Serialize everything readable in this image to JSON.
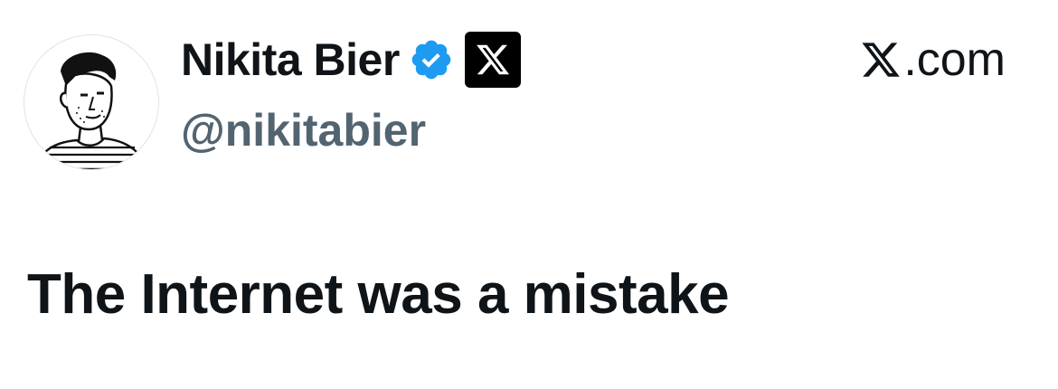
{
  "author": {
    "display_name": "Nikita Bier",
    "handle": "@nikitabier",
    "avatar_icon": "avatar-illustration",
    "verified_icon": "verified-checkmark-icon",
    "verified_color": "#1d9bf0",
    "affiliate_icon": "x-logo-icon"
  },
  "source": {
    "logo_icon": "x-logo-icon",
    "text": ".com"
  },
  "tweet": {
    "text": "The Internet was a mistake"
  },
  "colors": {
    "text": "#0f1419",
    "handle": "#536471",
    "background": "#ffffff"
  }
}
